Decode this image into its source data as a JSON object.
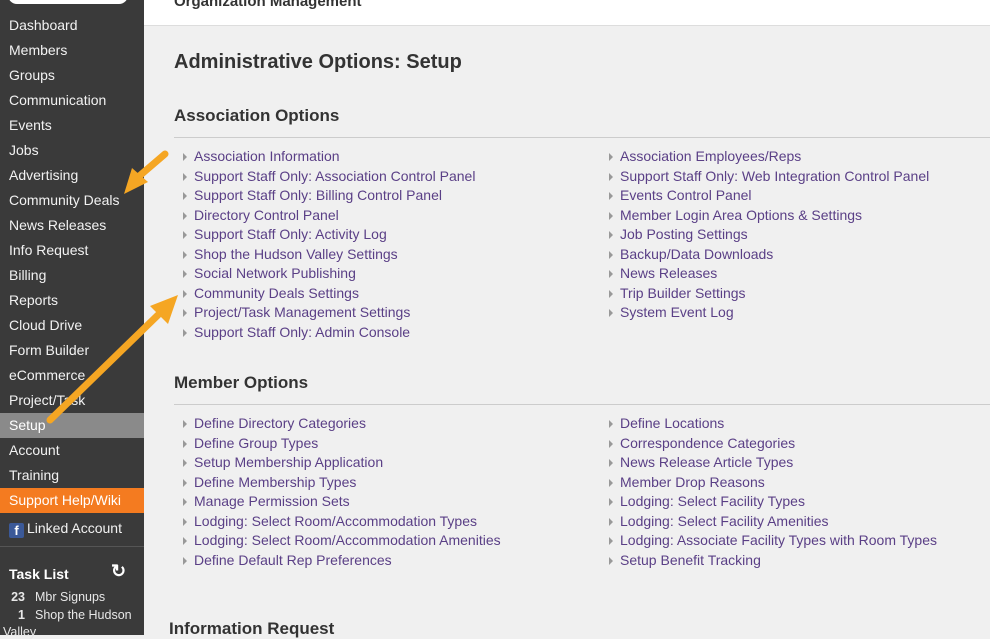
{
  "sidebar": {
    "items": [
      {
        "label": "Dashboard"
      },
      {
        "label": "Members"
      },
      {
        "label": "Groups"
      },
      {
        "label": "Communication"
      },
      {
        "label": "Events"
      },
      {
        "label": "Jobs"
      },
      {
        "label": "Advertising"
      },
      {
        "label": "Community Deals"
      },
      {
        "label": "News Releases"
      },
      {
        "label": "Info Request"
      },
      {
        "label": "Billing"
      },
      {
        "label": "Reports"
      },
      {
        "label": "Cloud Drive"
      },
      {
        "label": "Form Builder"
      },
      {
        "label": "eCommerce"
      },
      {
        "label": "Project/Task"
      },
      {
        "label": "Setup"
      },
      {
        "label": "Account"
      },
      {
        "label": "Training"
      }
    ],
    "help_label": "Support Help/Wiki",
    "linked_account_label": "Linked Account",
    "facebook_glyph": "f"
  },
  "tasks": {
    "title": "Task List",
    "refresh_icon": "↻",
    "items": [
      {
        "count": "23",
        "label": "Mbr Signups"
      },
      {
        "count": "1",
        "label": "Shop the Hudson"
      }
    ],
    "overflow_text": "Valley"
  },
  "header": {
    "title": "Organization Management"
  },
  "main": {
    "page_title": "Administrative Options: Setup",
    "association": {
      "title": "Association Options",
      "left": [
        "Association Information",
        "Support Staff Only: Association Control Panel",
        "Support Staff Only: Billing Control Panel",
        "Directory Control Panel",
        "Support Staff Only: Activity Log",
        "Shop the Hudson Valley Settings",
        "Social Network Publishing",
        "Community Deals Settings",
        "Project/Task Management Settings",
        "Support Staff Only: Admin Console"
      ],
      "right": [
        "Association Employees/Reps",
        "Support Staff Only: Web Integration Control Panel",
        "Events Control Panel",
        "Member Login Area Options & Settings",
        "Job Posting Settings",
        "Backup/Data Downloads",
        "News Releases",
        "Trip Builder Settings",
        "System Event Log"
      ]
    },
    "member": {
      "title": "Member Options",
      "left": [
        "Define Directory Categories",
        "Define Group Types",
        "Setup Membership Application",
        "Define Membership Types",
        "Manage Permission Sets",
        "Lodging: Select Room/Accommodation Types",
        "Lodging: Select Room/Accommodation Amenities",
        "Define Default Rep Preferences"
      ],
      "right": [
        "Define Locations",
        "Correspondence Categories",
        "News Release Article Types",
        "Member Drop Reasons",
        "Lodging: Select Facility Types",
        "Lodging: Select Facility Amenities",
        "Lodging: Associate Facility Types with Room Types",
        "Setup Benefit Tracking"
      ]
    },
    "info_request_title": "Information Request"
  },
  "colors": {
    "sidebar_bg": "#3a3a3a",
    "active_bg": "#8a8a8a",
    "help_bg": "#f47b20",
    "link": "#5a3f86",
    "arrow": "#f5a623"
  }
}
